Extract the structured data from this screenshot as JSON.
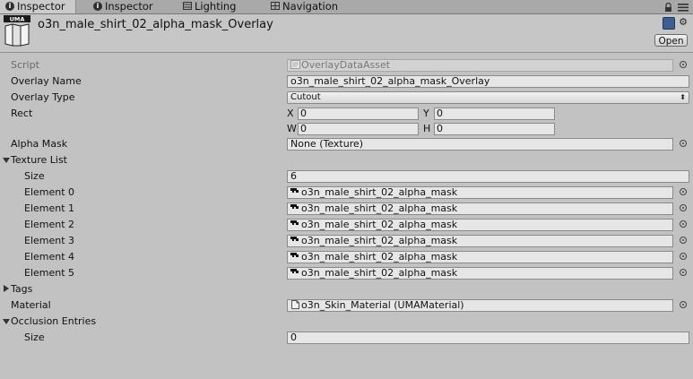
{
  "tabs": [
    {
      "label": "Inspector",
      "icon": "info-icon",
      "active": true
    },
    {
      "label": "Inspector",
      "icon": "info-icon",
      "active": false
    },
    {
      "label": "Lighting",
      "icon": "lighting-icon",
      "active": false
    },
    {
      "label": "Navigation",
      "icon": "navigation-icon",
      "active": false
    }
  ],
  "header": {
    "title": "o3n_male_shirt_02_alpha_mask_Overlay",
    "logo_text": "UMA",
    "open_label": "Open"
  },
  "fields": {
    "script": {
      "label": "Script",
      "value": "OverlayDataAsset"
    },
    "overlay_name": {
      "label": "Overlay Name",
      "value": "o3n_male_shirt_02_alpha_mask_Overlay"
    },
    "overlay_type": {
      "label": "Overlay Type",
      "value": "Cutout"
    },
    "rect": {
      "label": "Rect",
      "x_label": "X",
      "x": "0",
      "y_label": "Y",
      "y": "0",
      "w_label": "W",
      "w": "0",
      "h_label": "H",
      "h": "0"
    },
    "alpha_mask": {
      "label": "Alpha Mask",
      "value": "None (Texture)"
    },
    "texture_list": {
      "label": "Texture List",
      "size_label": "Size",
      "size": "6",
      "elements": [
        {
          "label": "Element 0",
          "value": "o3n_male_shirt_02_alpha_mask"
        },
        {
          "label": "Element 1",
          "value": "o3n_male_shirt_02_alpha_mask"
        },
        {
          "label": "Element 2",
          "value": "o3n_male_shirt_02_alpha_mask"
        },
        {
          "label": "Element 3",
          "value": "o3n_male_shirt_02_alpha_mask"
        },
        {
          "label": "Element 4",
          "value": "o3n_male_shirt_02_alpha_mask"
        },
        {
          "label": "Element 5",
          "value": "o3n_male_shirt_02_alpha_mask"
        }
      ]
    },
    "tags": {
      "label": "Tags"
    },
    "material": {
      "label": "Material",
      "value": "o3n_Skin_Material (UMAMaterial)"
    },
    "occlusion": {
      "label": "Occlusion Entries",
      "size_label": "Size",
      "size": "0"
    }
  }
}
